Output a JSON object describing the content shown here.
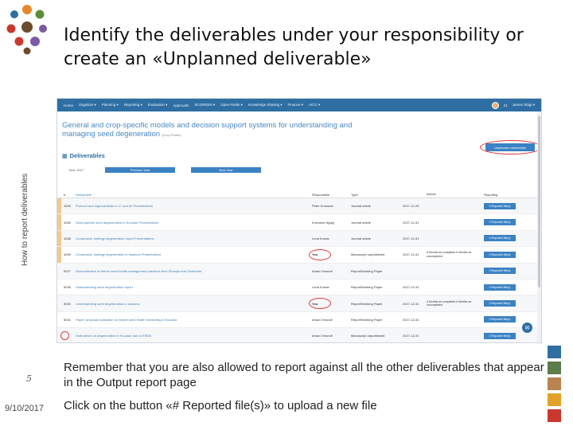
{
  "slide": {
    "title": "Identify the deliverables under your responsibility or create an «Unplanned deliverable»",
    "side_label": "How to report deliverables",
    "slide_number": "5",
    "date": "9/10/2017",
    "bullets": [
      "Remember that you are also allowed to report against all the other deliverables that appear in the Output report page",
      "Click on the button «# Reported file(s)» to upload a new file"
    ],
    "logo_colors": [
      "#e58a2b",
      "#5b8e3a",
      "#2e6ea3",
      "#c9382e",
      "#7a5aa6",
      "#6d4b2f"
    ],
    "square_colors": [
      "#2e6ea3",
      "#5b7d4a",
      "#b9824f",
      "#e2a22a",
      "#c9382e"
    ]
  },
  "app": {
    "nav": {
      "items": [
        "Home",
        "Organize ▾",
        "Planning ▾",
        "Reporting ▾",
        "Evaluation ▾",
        "Approvals",
        "SCOREEN ▾",
        "Open Fields ▾",
        "Knowledge Sharing ▾",
        "Finance ▾",
        "AICC ▾"
      ],
      "user_count": "21",
      "user_name": "James Slagt ▾"
    },
    "project": {
      "title": "General and crop-specific models and decision support systems for understanding and managing seed degeneration",
      "subtitle": "(Crop Phase)"
    },
    "unplanned_button": "Unplanned deliverable",
    "section_title": "Deliverables",
    "filter": {
      "label": "Year: 2017",
      "previous": "Previous Year",
      "next": "Next Year"
    },
    "table": {
      "headers": [
        "#",
        "Deliverable",
        "Responsible",
        "Type",
        "",
        "Actions",
        "Reporting"
      ],
      "rows": [
        {
          "id": "4259",
          "deliverable": "Protocol and regional fields in 17 and be Presentations",
          "responsible": "Peter Kromann",
          "type": "Journal article",
          "date": "2017-12-29",
          "actions": "",
          "report": "0 Reported file(s)",
          "bar": "#f2c98f"
        },
        {
          "id": "4260",
          "deliverable": "Seed-specific seed degeneration in Ecuador Presentations",
          "responsible": "Kromann Ngugi",
          "type": "Journal article",
          "date": "2017-12-31",
          "actions": "",
          "report": "0 Reported file(s)",
          "bar": "#f2c98f"
        },
        {
          "id": "4258",
          "deliverable": "Crossroads, strategy degeneration report Presentations",
          "responsible": "Lena Kumar",
          "type": "Journal article",
          "date": "2017-12-31",
          "actions": "",
          "report": "0 Reported file(s)",
          "bar": "#f2c98f"
        },
        {
          "id": "4259",
          "deliverable": "Crossroads, strategy degeneration in seasons Presentations",
          "responsible": "You",
          "type": "Manuscript unpublished",
          "date": "2017-12-31",
          "actions": "# Months as completed # Months as uncompleted",
          "report": "0 Reported file(s)",
          "bar": "#f2c98f"
        },
        {
          "id": "5027",
          "deliverable": "Demonstration of farmer seed health management practices from Ethiopia and Southeast",
          "responsible": "Aman Omondi",
          "type": "Report/Working Paper",
          "date": "",
          "actions": "",
          "report": "0 Reported file(s)",
          "bar": ""
        },
        {
          "id": "5036",
          "deliverable": "Understanding seed degeneration report",
          "responsible": "Lena Kumar",
          "type": "Report/Working Paper",
          "date": "2017-12-31",
          "actions": "",
          "report": "0 Reported file(s)",
          "bar": ""
        },
        {
          "id": "5040",
          "deliverable": "Understanding seed degeneration in seasons",
          "responsible": "You",
          "type": "Report/Working Paper",
          "date": "2017-12-31",
          "actions": "# Months as completed # Months as uncompleted",
          "report": "0 Reported file(s)",
          "bar": ""
        },
        {
          "id": "5041",
          "deliverable": "Paper: proposal evaluation on farmer seed health monitoring in Ecuador",
          "responsible": "Aman Omondi",
          "type": "Report/Working Paper",
          "date": "2017-12-31",
          "actions": "",
          "report": "0 Reported file(s)",
          "bar": ""
        },
        {
          "id": "",
          "deliverable": "Draft article on degeneration in Ecuador due to ESDB",
          "responsible": "Aman Omondi",
          "type": "Manuscript unpublished",
          "date": "2017-12-31",
          "actions": "",
          "report": "0 Reported file(s)",
          "bar": ""
        }
      ]
    }
  }
}
